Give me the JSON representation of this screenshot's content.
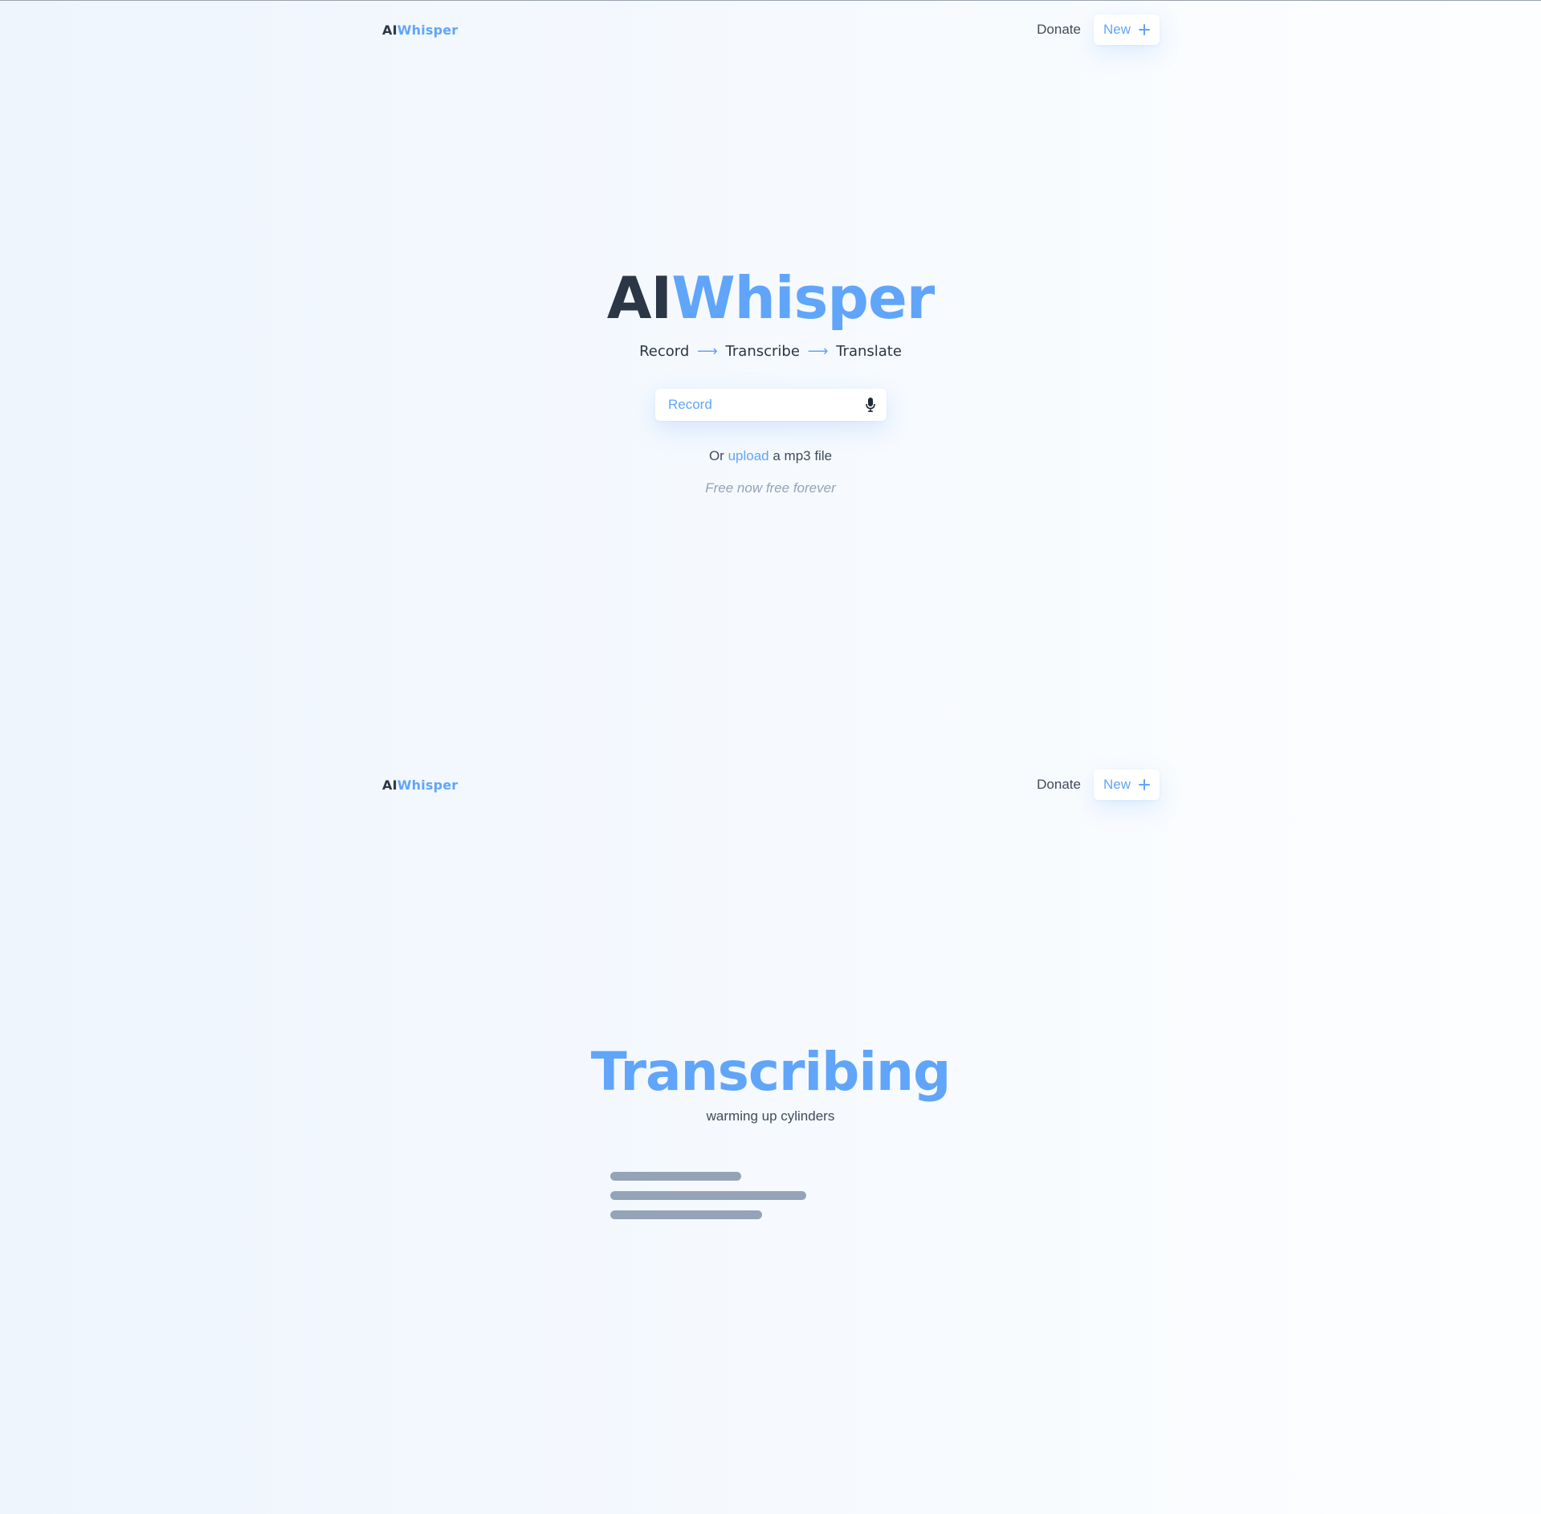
{
  "colors": {
    "accent": "#60a5fa",
    "dark": "#2b3646",
    "muted": "#94a3b8"
  },
  "header": {
    "logo_ai": "AI",
    "logo_whisper": "Whisper",
    "donate_label": "Donate",
    "new_label": "New",
    "new_icon": "plus-icon"
  },
  "home": {
    "title_ai": "AI",
    "title_whisper": "Whisper",
    "steps": [
      "Record",
      "Transcribe",
      "Translate"
    ],
    "arrow": "⟶",
    "record_label": "Record",
    "record_icon": "microphone-icon",
    "upload_prefix": "Or",
    "upload_link": "upload",
    "upload_suffix": "a mp3 file",
    "free_text": "Free now free forever"
  },
  "transcribing": {
    "title": "Transcribing",
    "subtitle": "warming up cylinders",
    "skeleton_lines": 3
  }
}
